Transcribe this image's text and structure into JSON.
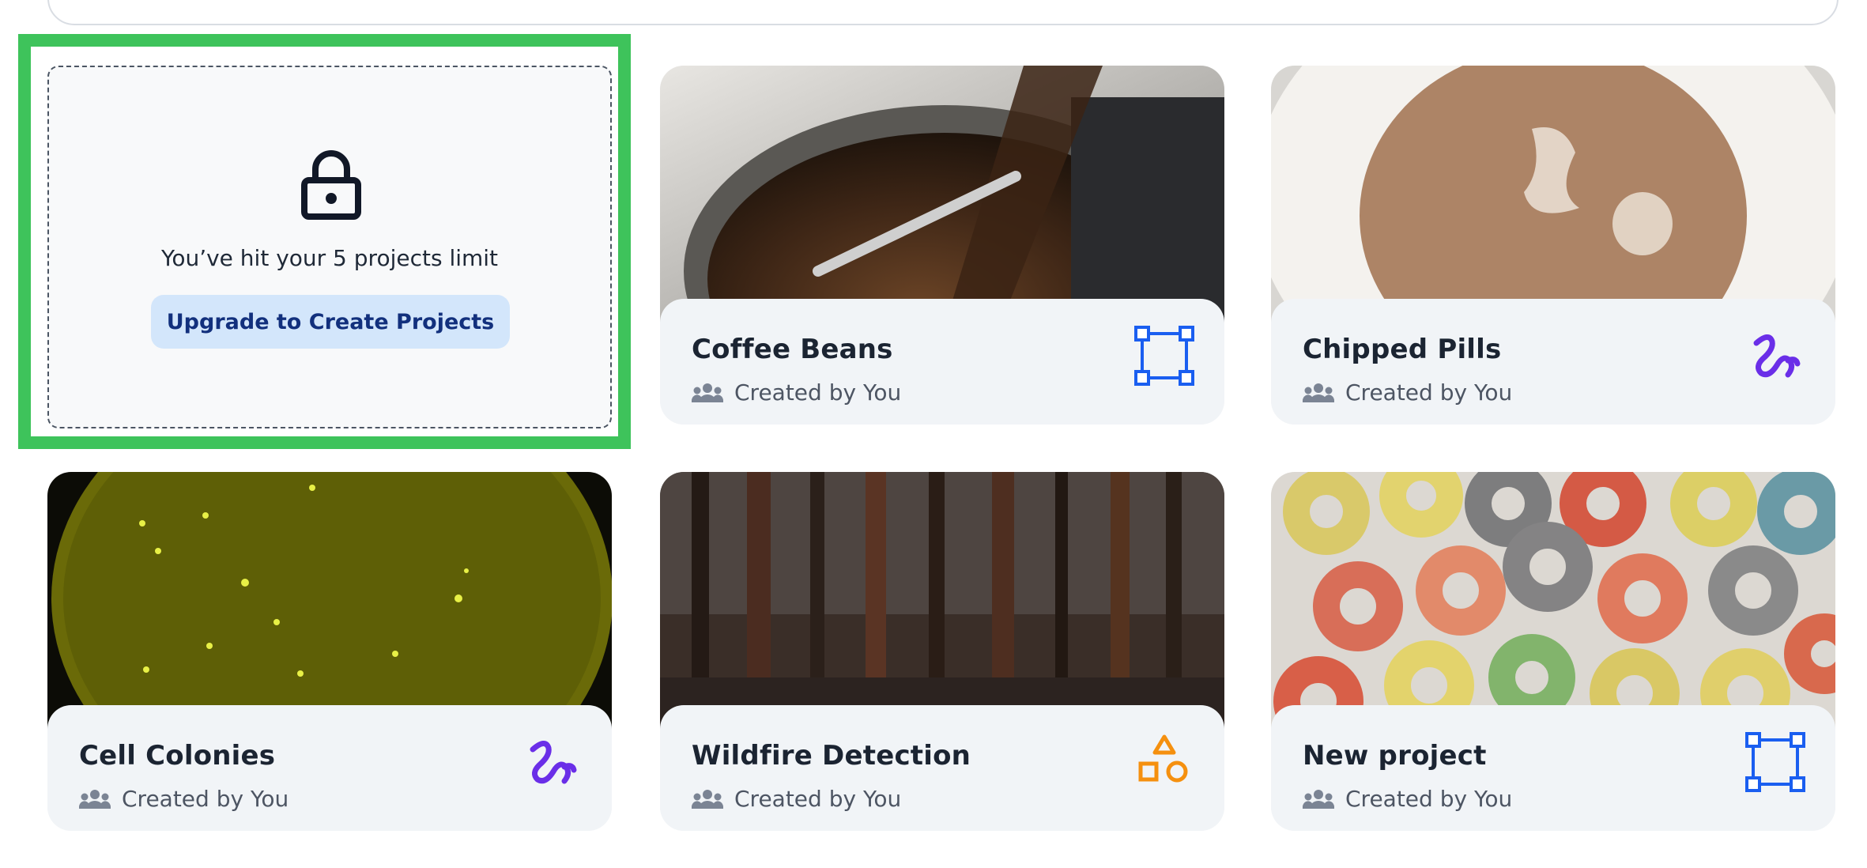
{
  "limit_card": {
    "message": "You’ve hit your 5 projects limit",
    "button_label": "Upgrade to Create Projects",
    "icon": "lock-icon"
  },
  "projects": [
    {
      "title": "Coffee Beans",
      "created_by": "Created by You",
      "type_icon": "bounding-box-icon",
      "thumb": "coffee-roaster"
    },
    {
      "title": "Chipped Pills",
      "created_by": "Created by You",
      "type_icon": "polygon-squiggle-icon",
      "thumb": "brown-pill"
    },
    {
      "title": "Cell Colonies",
      "created_by": "Created by You",
      "type_icon": "polygon-squiggle-icon",
      "thumb": "petri-dish"
    },
    {
      "title": "Wildfire Detection",
      "created_by": "Created by You",
      "type_icon": "shapes-icon",
      "thumb": "forest"
    },
    {
      "title": "New project",
      "created_by": "Created by You",
      "type_icon": "bounding-box-icon",
      "thumb": "cereal-rings"
    }
  ],
  "colors": {
    "highlight": "#3ec35b",
    "bbox_icon": "#1a5ef0",
    "squiggle_icon": "#6a2ee8",
    "shapes_icon": "#f5900f",
    "button_bg": "#d3e6fb",
    "button_text": "#12307d"
  }
}
